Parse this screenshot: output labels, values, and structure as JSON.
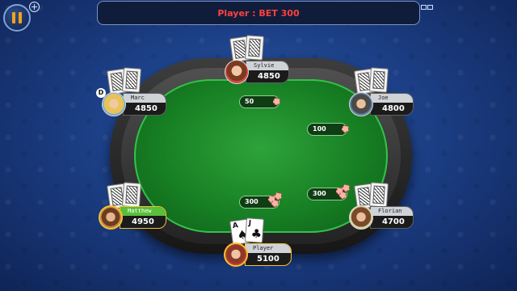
{
  "header": {
    "message": "Player : BET 300"
  },
  "icons": {
    "pause": "pause-icon",
    "add": "plus-icon",
    "dealer": "D"
  },
  "players": {
    "sylvie": {
      "name": "Sylvie",
      "chips": "4850"
    },
    "marc": {
      "name": "Marc",
      "chips": "4850"
    },
    "joe": {
      "name": "Joe",
      "chips": "4800"
    },
    "matthew": {
      "name": "Matthew",
      "chips": "4950"
    },
    "florian": {
      "name": "Florian",
      "chips": "4700"
    },
    "player": {
      "name": "Player",
      "chips": "5100"
    }
  },
  "bets": {
    "top_left": "50",
    "right_upper": "100",
    "bottom_left": "300",
    "right_lower": "300"
  },
  "player_hand": {
    "card1": {
      "rank": "A",
      "suit": "♠"
    },
    "card2": {
      "rank": "J",
      "suit": "♣"
    }
  },
  "colors": {
    "message_text": "#ff4040",
    "felt": "#178024",
    "active_highlight": "#f1c232"
  }
}
